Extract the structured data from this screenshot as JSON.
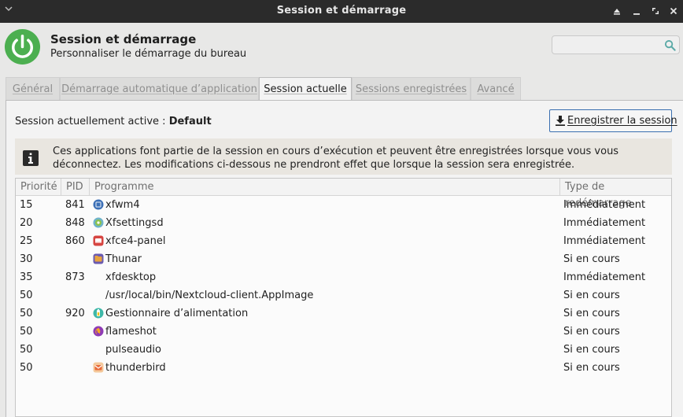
{
  "window": {
    "title": "Session et démarrage",
    "controls": [
      "window-menu",
      "shade",
      "maximize",
      "close"
    ]
  },
  "header": {
    "title": "Session et démarrage",
    "subtitle": "Personnaliser le démarrage du bureau",
    "icon": "power-icon",
    "accent_color": "#4caf50"
  },
  "search": {
    "value": "",
    "placeholder": "",
    "icon": "search-icon",
    "icon_color": "#5aa9a6"
  },
  "tabs": [
    {
      "label": "Général",
      "active": false
    },
    {
      "label": "Démarrage automatique d’application",
      "active": false
    },
    {
      "label": "Session actuelle",
      "active": true
    },
    {
      "label": "Sessions enregistrées",
      "active": false
    },
    {
      "label": "Avancé",
      "active": false
    }
  ],
  "session": {
    "label": "Session actuellement active : ",
    "name": "Default",
    "save_button": "Enregistrer la session"
  },
  "info": {
    "icon": "info-icon",
    "message": "Ces applications font partie de la session en cours d’exécution et peuvent être enregistrées lorsque vous vous déconnectez. Les modifications ci-dessous ne prendront effet que lorsque la session sera enregistrée."
  },
  "table": {
    "columns": [
      "Priorité",
      "PID",
      "Programme",
      "Type de redémarrage"
    ],
    "rows": [
      {
        "priority": "15",
        "pid": "841",
        "program": "xfwm4",
        "restart": "Immédiatement",
        "icon": "xfwm4-icon",
        "icon_color": "#3b6fb6"
      },
      {
        "priority": "20",
        "pid": "848",
        "program": "Xfsettingsd",
        "restart": "Immédiatement",
        "icon": "xfsettingsd-icon",
        "icon_color": "#8bc34a"
      },
      {
        "priority": "25",
        "pid": "860",
        "program": "xfce4-panel",
        "restart": "Immédiatement",
        "icon": "xfce4-panel-icon",
        "icon_color": "#d64541"
      },
      {
        "priority": "30",
        "pid": "",
        "program": "Thunar",
        "restart": "Si en cours",
        "icon": "thunar-icon",
        "icon_color": "#e8a33d"
      },
      {
        "priority": "35",
        "pid": "873",
        "program": "xfdesktop",
        "restart": "Immédiatement",
        "icon": "",
        "icon_color": ""
      },
      {
        "priority": "50",
        "pid": "",
        "program": "/usr/local/bin/Nextcloud-client.AppImage",
        "restart": "Si en cours",
        "icon": "",
        "icon_color": ""
      },
      {
        "priority": "50",
        "pid": "920",
        "program": "Gestionnaire d’alimentation",
        "restart": "Si en cours",
        "icon": "power-manager-icon",
        "icon_color": "#3fb8a8"
      },
      {
        "priority": "50",
        "pid": "",
        "program": "flameshot",
        "restart": "Si en cours",
        "icon": "flameshot-icon",
        "icon_color": "#8e3bb5"
      },
      {
        "priority": "50",
        "pid": "",
        "program": "pulseaudio",
        "restart": "Si en cours",
        "icon": "",
        "icon_color": ""
      },
      {
        "priority": "50",
        "pid": "",
        "program": "thunderbird",
        "restart": "Si en cours",
        "icon": "thunderbird-icon",
        "icon_color": "#e86a3a"
      }
    ]
  }
}
